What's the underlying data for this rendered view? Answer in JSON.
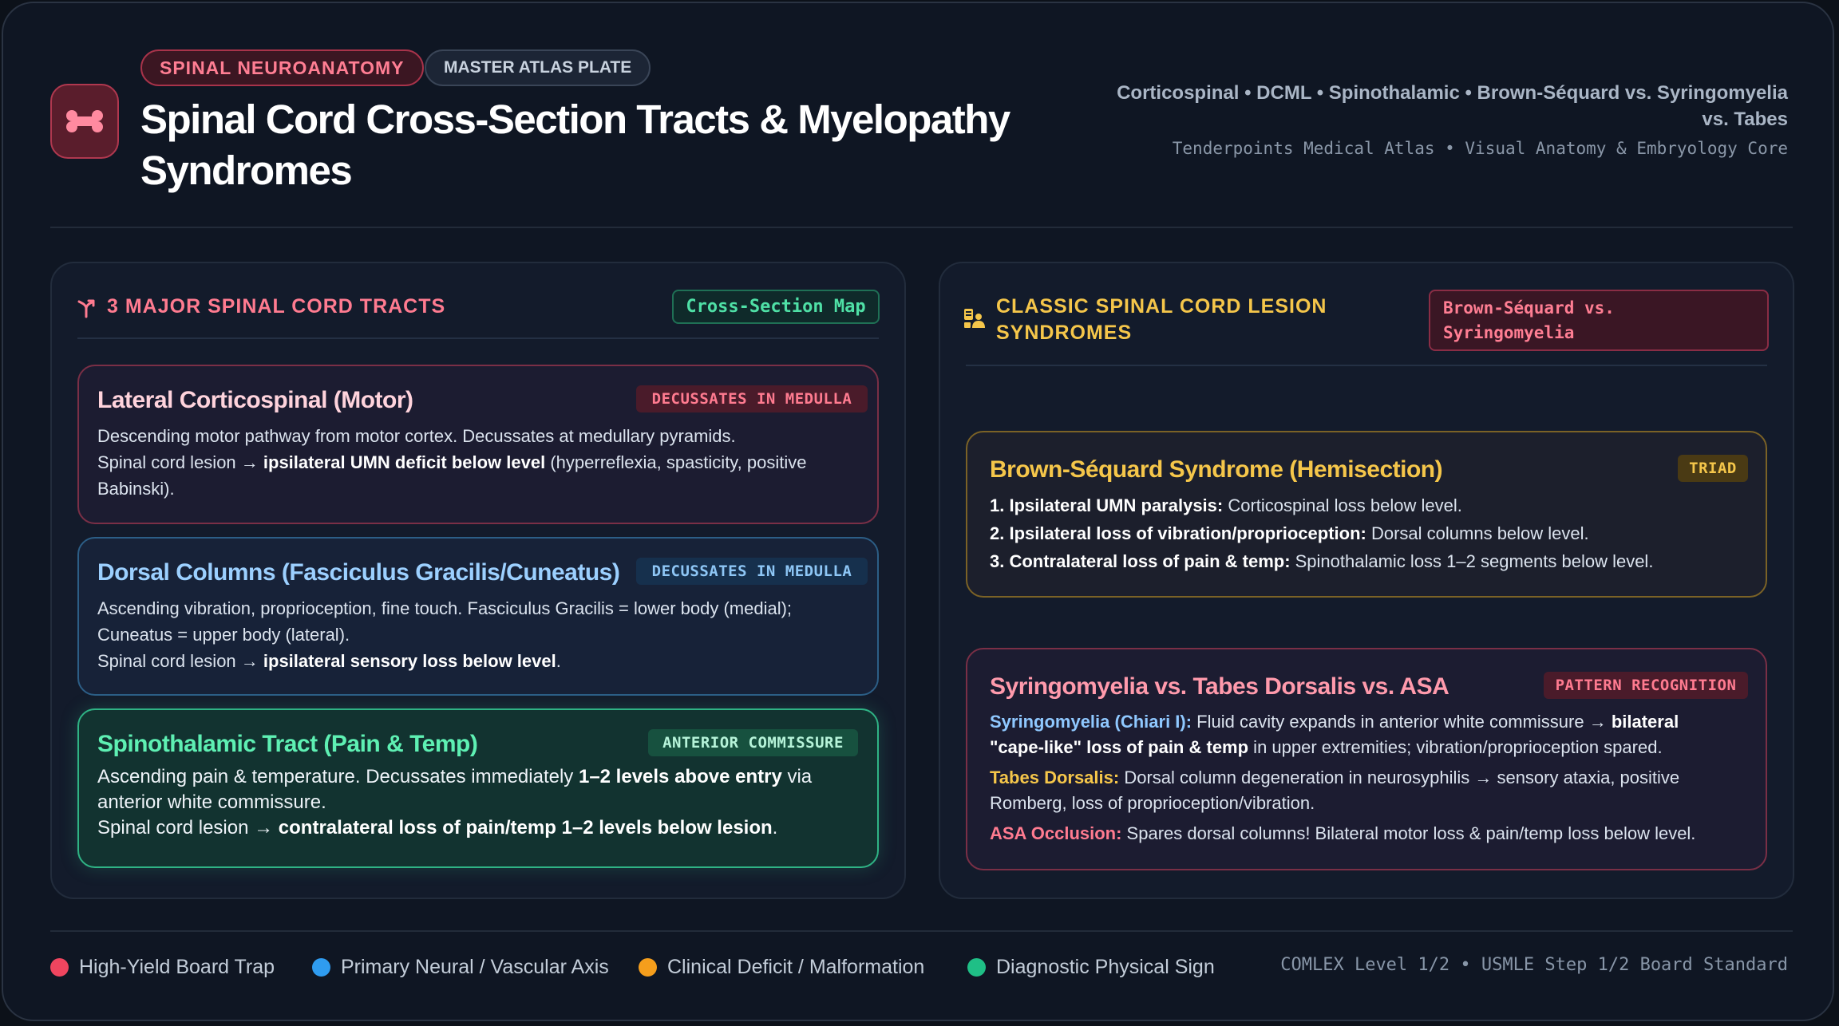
{
  "header": {
    "category_pill": "SPINAL NEUROANATOMY",
    "plate_pill": "MASTER ATLAS PLATE",
    "title_line1": "Spinal Cord Cross-Section Tracts & Myelopathy",
    "title_line2": "Syndromes",
    "subtitle_line1": "Corticospinal • DCML • Spinothalamic • Brown-Séquard vs. Syringomyelia",
    "subtitle_line2": "vs. Tabes",
    "source": "Tenderpoints Medical Atlas • Visual Anatomy & Embryology Core",
    "logo_icon": "bone-icon"
  },
  "left_panel": {
    "icon": "fork-arrow-icon",
    "title": "3 MAJOR SPINAL CORD TRACTS",
    "badge": "Cross-Section Map",
    "cards": [
      {
        "title": "Lateral Corticospinal (Motor)",
        "tag": "DECUSSATES IN MEDULLA",
        "line1": "Descending motor pathway from motor cortex. Decussates at medullary pyramids.",
        "line2_pre": "Spinal cord lesion → ",
        "line2_bold": "ipsilateral UMN deficit below level",
        "line2_post": " (hyperreflexia, spasticity, positive",
        "line3": "Babinski)."
      },
      {
        "title": "Dorsal Columns (Fasciculus Gracilis/Cuneatus)",
        "tag": "DECUSSATES IN MEDULLA",
        "line1": "Ascending vibration, proprioception, fine touch. Fasciculus Gracilis = lower body (medial);",
        "line2": "Cuneatus = upper body (lateral).",
        "line3_pre": "Spinal cord lesion → ",
        "line3_bold": "ipsilateral sensory loss below level",
        "line3_post": "."
      },
      {
        "title": "Spinothalamic Tract (Pain & Temp)",
        "tag": "ANTERIOR COMMISSURE",
        "line1_pre": "Ascending pain & temperature. Decussates immediately ",
        "line1_bold": "1–2 levels above entry",
        "line1_post": " via",
        "line2": "anterior white commissure.",
        "line3_pre": "Spinal cord lesion → ",
        "line3_bold": "contralateral loss of pain/temp 1–2 levels below lesion",
        "line3_post": "."
      }
    ]
  },
  "right_panel": {
    "icon": "clipboard-user-icon",
    "title_line1": "CLASSIC SPINAL CORD LESION",
    "title_line2": "SYNDROMES",
    "badge_line1": "Brown-Séquard vs.",
    "badge_line2": "Syringomyelia",
    "cards": [
      {
        "title": "Brown-Séquard Syndrome (Hemisection)",
        "tag": "TRIAD",
        "items": [
          {
            "bold": "1. Ipsilateral UMN paralysis:",
            "text": " Corticospinal loss below level."
          },
          {
            "bold": "2. Ipsilateral loss of vibration/proprioception:",
            "text": " Dorsal columns below level."
          },
          {
            "bold": "3. Contralateral loss of pain & temp:",
            "text": " Spinothalamic loss 1–2 segments below level."
          }
        ]
      },
      {
        "title": "Syringomyelia vs. Tabes Dorsalis vs. ASA",
        "tag": "PATTERN RECOGNITION",
        "syr_label": "Syringomyelia (Chiari I):",
        "syr_text1": " Fluid cavity expands in anterior white commissure → ",
        "syr_bold1": "bilateral",
        "syr_bold2": "\"cape-like\" loss of pain & temp",
        "syr_text2": " in upper extremities; vibration/proprioception spared.",
        "tabes_label": "Tabes Dorsalis:",
        "tabes_text1": " Dorsal column degeneration in neurosyphilis → sensory ataxia, positive",
        "tabes_text2": "Romberg, loss of proprioception/vibration.",
        "asa_label": "ASA Occlusion:",
        "asa_text": " Spares dorsal columns! Bilateral motor loss & pain/temp loss below level."
      }
    ]
  },
  "legend": [
    {
      "label": "High-Yield Board Trap",
      "color": "#f0455f"
    },
    {
      "label": "Primary Neural / Vascular Axis",
      "color": "#2f9cf0"
    },
    {
      "label": "Clinical Deficit / Malformation",
      "color": "#f59e1c"
    },
    {
      "label": "Diagnostic Physical Sign",
      "color": "#1fbf86"
    }
  ],
  "footer_right": "COMLEX Level 1/2 • USMLE Step 1/2 Board Standard",
  "colors": {
    "accent_pink": "#ff7b90",
    "accent_yellow": "#f5c64a",
    "accent_green": "#4fe0a6",
    "accent_blue": "#9cd0ff"
  }
}
